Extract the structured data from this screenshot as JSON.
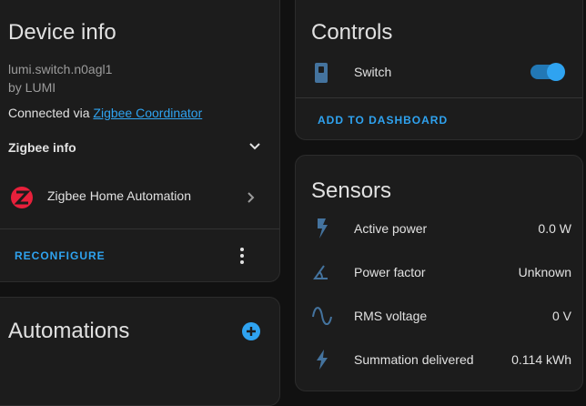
{
  "device_info": {
    "title": "Device info",
    "model": "lumi.switch.n0agl1",
    "manufacturer": "by LUMI",
    "connected_prefix": "Connected via ",
    "connected_link": "Zigbee Coordinator",
    "zigbee_info": "Zigbee info",
    "integration": "Zigbee Home Automation",
    "reconfigure": "RECONFIGURE"
  },
  "automations": {
    "title": "Automations"
  },
  "controls": {
    "title": "Controls",
    "switch_label": "Switch",
    "switch_on": true,
    "add_to_dashboard": "ADD TO DASHBOARD"
  },
  "sensors": {
    "title": "Sensors",
    "items": [
      {
        "label": "Active power",
        "value": "0.0 W",
        "icon": "flash-icon"
      },
      {
        "label": "Power factor",
        "value": "Unknown",
        "icon": "angle-icon"
      },
      {
        "label": "RMS voltage",
        "value": "0 V",
        "icon": "sine-wave-icon"
      },
      {
        "label": "Summation delivered",
        "value": "0.114 kWh",
        "icon": "lightning-icon"
      }
    ]
  },
  "colors": {
    "accent": "#2fa3f0",
    "icon": "#44739e",
    "zha": "#e8203b"
  }
}
